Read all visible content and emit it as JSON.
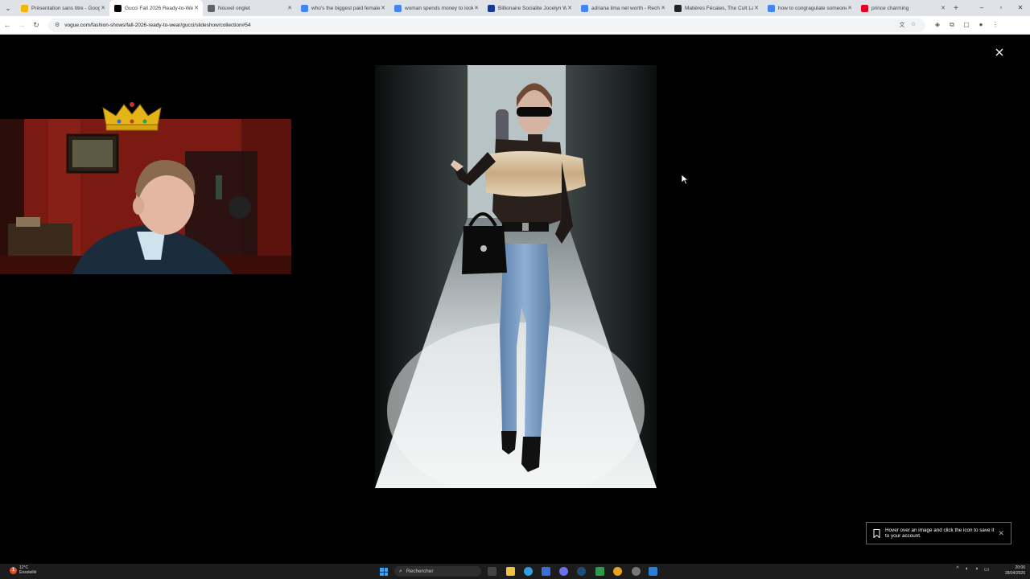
{
  "browser": {
    "tabs": [
      {
        "title": "Présentation sans titre - Goog",
        "favicon": "slides-icon",
        "favicon_color": "#f4b400",
        "active": false
      },
      {
        "title": "Gucci Fall 2026 Ready-to-Wea",
        "favicon": "vogue-icon",
        "favicon_color": "#000000",
        "active": true
      },
      {
        "title": "Nouvel onglet",
        "favicon": "chrome-icon",
        "favicon_color": "#5f6368",
        "active": false
      },
      {
        "title": "who's the biggest paid female",
        "favicon": "google-icon",
        "favicon_color": "#4285f4",
        "active": false
      },
      {
        "title": "woman spends money to look",
        "favicon": "google-icon",
        "favicon_color": "#4285f4",
        "active": false
      },
      {
        "title": "Billionaire Socialite Jocelyn W",
        "favicon": "news-icon",
        "favicon_color": "#1a3a8f",
        "active": false
      },
      {
        "title": "adriana lima net worth - Rech",
        "favicon": "google-icon",
        "favicon_color": "#4285f4",
        "active": false
      },
      {
        "title": "Matières Fécales, The Cult Lab",
        "favicon": "a-icon",
        "favicon_color": "#222222",
        "active": false
      },
      {
        "title": "how to congragulate someone",
        "favicon": "google-icon",
        "favicon_color": "#4285f4",
        "active": false
      },
      {
        "title": "prince charming",
        "favicon": "pinterest-icon",
        "favicon_color": "#e60023",
        "active": false
      }
    ],
    "url": "vogue.com/fashion-shows/fall-2026-ready-to-wear/gucci/slideshow/collection#54"
  },
  "toast": {
    "message": "Hover over an image and click the icon to save it to your account."
  },
  "taskbar": {
    "weather_temp": "12°C",
    "weather_desc": "Ensoleillé",
    "search_placeholder": "Rechercher",
    "time": "20:06",
    "date": "28/04/2026"
  }
}
